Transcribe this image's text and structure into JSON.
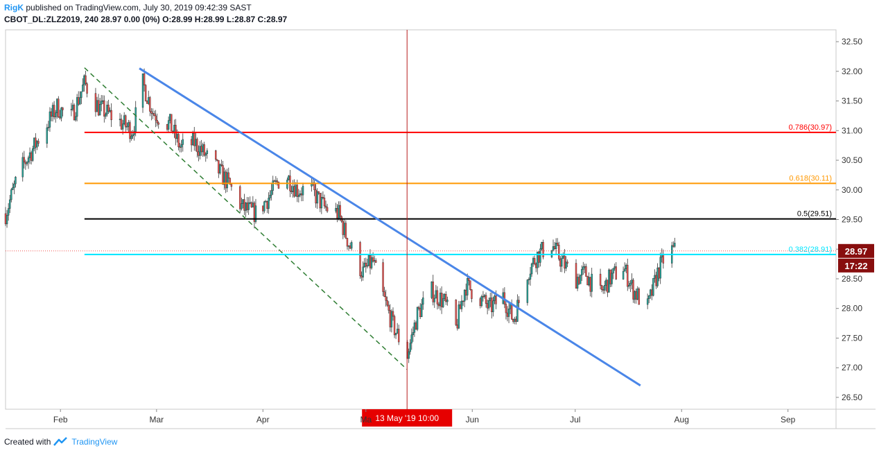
{
  "header": {
    "author": "RigK",
    "published": "published on TradingView.com, July 30, 2019 09:42:39 SAST",
    "symbol_line": "CBOT_DL:ZLZ2019, 240  28.97 0.00 (0%)  O:28.99 H:28.99 L:28.87 C:28.97"
  },
  "footer": {
    "created_with": "Created with",
    "brand": "TradingView"
  },
  "colors": {
    "up_candle": "#26a69a",
    "down_candle": "#ef5350",
    "trendline": "#4a86e8",
    "channel": "#2e7d32",
    "fib_0786": "#ff0000",
    "fib_0618": "#ff9800",
    "fib_05": "#000000",
    "fib_0382": "#00e5ff",
    "crosshair": "#b71c1c",
    "price_badge": "#880e0e"
  },
  "chart_data": {
    "type": "candlestick",
    "symbol": "CBOT_DL:ZLZ2019",
    "interval": "240",
    "last_price": "28.97",
    "countdown": "17:22",
    "y_axis": {
      "ylim": [
        26.3,
        32.7
      ],
      "ticks": [
        "26.50",
        "27.00",
        "27.50",
        "28.00",
        "28.50",
        "29.00",
        "29.50",
        "30.00",
        "30.50",
        "31.00",
        "31.50",
        "32.00",
        "32.50"
      ]
    },
    "x_axis": {
      "xlim": [
        "2019-01-16",
        "2019-09-15"
      ],
      "ticks": [
        {
          "label": "Feb",
          "date": "2019-02-01"
        },
        {
          "label": "Mar",
          "date": "2019-03-01"
        },
        {
          "label": "Apr",
          "date": "2019-04-01"
        },
        {
          "label": "Ma",
          "date": "2019-05-01"
        },
        {
          "label": "Jun",
          "date": "2019-06-01"
        },
        {
          "label": "Jul",
          "date": "2019-07-01"
        },
        {
          "label": "Aug",
          "date": "2019-08-01"
        },
        {
          "label": "Sep",
          "date": "2019-09-01"
        }
      ]
    },
    "crosshair": {
      "date": "2019-05-13",
      "label": "13 May '19   10:00"
    },
    "fib_levels": [
      {
        "label": "0.786(30.97)",
        "value": 30.97,
        "color": "#ff0000"
      },
      {
        "label": "0.618(30.11)",
        "value": 30.11,
        "color": "#ff9800"
      },
      {
        "label": "0.5(29.51)",
        "value": 29.51,
        "color": "#000000"
      },
      {
        "label": "0.382(28.91)",
        "value": 28.91,
        "color": "#00e5ff"
      }
    ],
    "fib_start_date": "2019-02-08",
    "trendline": {
      "start": {
        "date": "2019-02-24",
        "price": 32.05
      },
      "end": {
        "date": "2019-07-20",
        "price": 26.7
      }
    },
    "channel_line": {
      "start": {
        "date": "2019-02-08",
        "price": 32.06
      },
      "end": {
        "date": "2019-05-13",
        "price": 26.97
      }
    },
    "price_path": [
      {
        "date": "2019-01-16",
        "price": 29.6
      },
      {
        "date": "2019-01-20",
        "price": 30.3
      },
      {
        "date": "2019-01-26",
        "price": 30.9
      },
      {
        "date": "2019-01-31",
        "price": 31.4
      },
      {
        "date": "2019-02-04",
        "price": 31.2
      },
      {
        "date": "2019-02-08",
        "price": 31.8
      },
      {
        "date": "2019-02-12",
        "price": 31.4
      },
      {
        "date": "2019-02-17",
        "price": 31.2
      },
      {
        "date": "2019-02-22",
        "price": 31.0
      },
      {
        "date": "2019-02-25",
        "price": 31.8
      },
      {
        "date": "2019-02-28",
        "price": 31.3
      },
      {
        "date": "2019-03-05",
        "price": 31.1
      },
      {
        "date": "2019-03-08",
        "price": 30.7
      },
      {
        "date": "2019-03-12",
        "price": 30.8
      },
      {
        "date": "2019-03-15",
        "price": 30.6
      },
      {
        "date": "2019-03-18",
        "price": 30.4
      },
      {
        "date": "2019-03-22",
        "price": 30.1
      },
      {
        "date": "2019-03-26",
        "price": 29.7
      },
      {
        "date": "2019-03-30",
        "price": 29.6
      },
      {
        "date": "2019-04-03",
        "price": 29.9
      },
      {
        "date": "2019-04-07",
        "price": 30.3
      },
      {
        "date": "2019-04-11",
        "price": 30.0
      },
      {
        "date": "2019-04-15",
        "price": 30.0
      },
      {
        "date": "2019-04-19",
        "price": 29.7
      },
      {
        "date": "2019-04-23",
        "price": 29.6
      },
      {
        "date": "2019-04-26",
        "price": 29.1
      },
      {
        "date": "2019-04-30",
        "price": 28.6
      },
      {
        "date": "2019-05-03",
        "price": 28.8
      },
      {
        "date": "2019-05-06",
        "price": 28.2
      },
      {
        "date": "2019-05-09",
        "price": 27.7
      },
      {
        "date": "2019-05-13",
        "price": 27.2
      },
      {
        "date": "2019-05-16",
        "price": 27.9
      },
      {
        "date": "2019-05-20",
        "price": 28.3
      },
      {
        "date": "2019-05-24",
        "price": 28.1
      },
      {
        "date": "2019-05-27",
        "price": 27.6
      },
      {
        "date": "2019-05-30",
        "price": 28.4
      },
      {
        "date": "2019-06-03",
        "price": 28.2
      },
      {
        "date": "2019-06-06",
        "price": 28.0
      },
      {
        "date": "2019-06-10",
        "price": 28.2
      },
      {
        "date": "2019-06-13",
        "price": 27.8
      },
      {
        "date": "2019-06-17",
        "price": 28.6
      },
      {
        "date": "2019-06-20",
        "price": 28.9
      },
      {
        "date": "2019-06-24",
        "price": 29.1
      },
      {
        "date": "2019-06-27",
        "price": 28.8
      },
      {
        "date": "2019-07-01",
        "price": 28.5
      },
      {
        "date": "2019-07-04",
        "price": 28.6
      },
      {
        "date": "2019-07-08",
        "price": 28.2
      },
      {
        "date": "2019-07-11",
        "price": 28.5
      },
      {
        "date": "2019-07-15",
        "price": 28.7
      },
      {
        "date": "2019-07-18",
        "price": 28.3
      },
      {
        "date": "2019-07-22",
        "price": 28.0
      },
      {
        "date": "2019-07-25",
        "price": 28.6
      },
      {
        "date": "2019-07-28",
        "price": 29.0
      },
      {
        "date": "2019-07-30",
        "price": 28.97
      }
    ]
  }
}
